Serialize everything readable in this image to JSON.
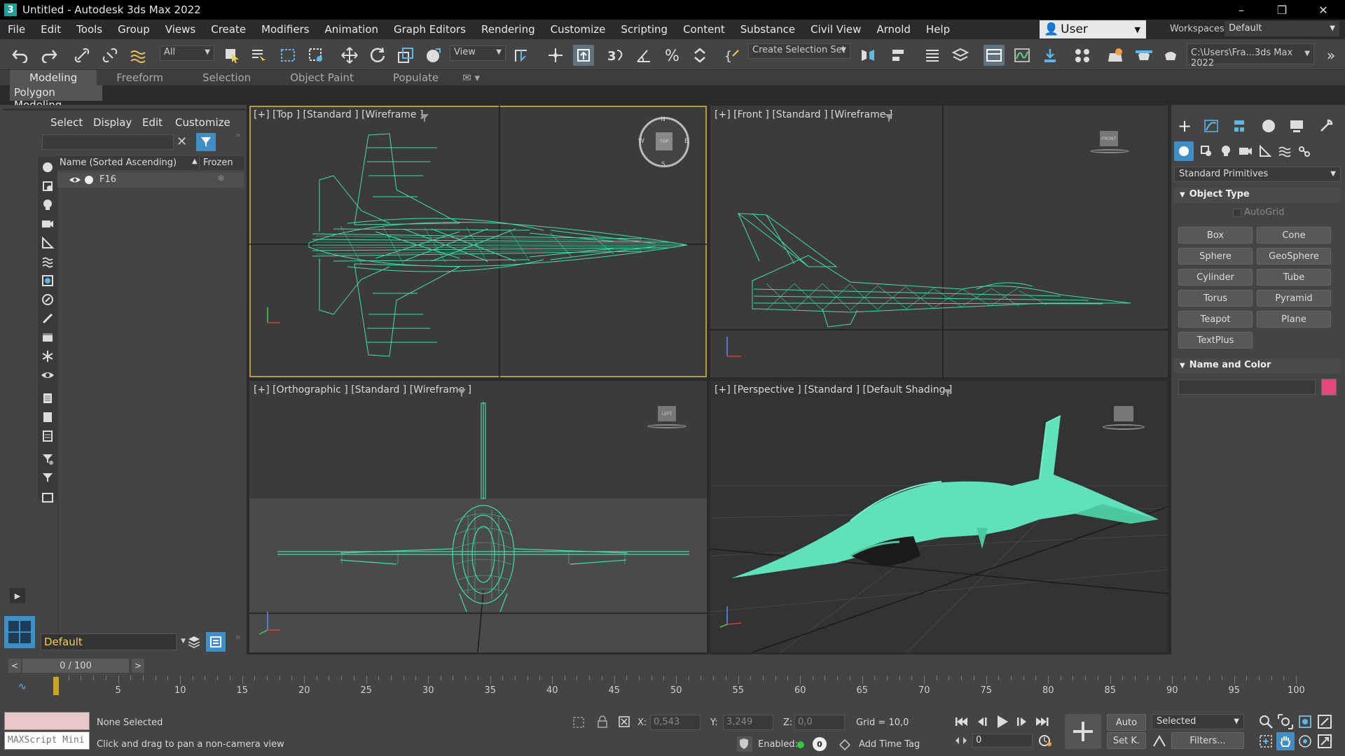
{
  "app": {
    "title": "Untitled - Autodesk 3ds Max 2022",
    "icon_letter": "3"
  },
  "menu": [
    "File",
    "Edit",
    "Tools",
    "Group",
    "Views",
    "Create",
    "Modifiers",
    "Animation",
    "Graph Editors",
    "Rendering",
    "Customize",
    "Scripting",
    "Content",
    "Substance",
    "Civil View",
    "Arnold",
    "Help"
  ],
  "user": {
    "name": "User",
    "workspaces_label": "Workspaces:",
    "workspace": "Default"
  },
  "toolbar": {
    "filter": "All",
    "ref_coord": "View",
    "selection_set": "Create Selection Set",
    "path": "C:\\Users\\Fra...3ds Max 2022"
  },
  "ribbon": {
    "tabs": [
      "Modeling",
      "Freeform",
      "Selection",
      "Object Paint",
      "Populate"
    ],
    "active": "Modeling",
    "subpanel": "Polygon Modeling"
  },
  "explorer": {
    "menus": [
      "Select",
      "Display",
      "Edit",
      "Customize"
    ],
    "col_name": "Name (Sorted Ascending)",
    "col_frozen": "Frozen",
    "items": [
      {
        "name": "F16"
      }
    ],
    "layer": "Default"
  },
  "viewports": {
    "top": "[+] [Top ] [Standard ] [Wireframe ]",
    "front": "[+] [Front ] [Standard ] [Wireframe ]",
    "ortho": "[+] [Orthographic ] [Standard ] [Wireframe ]",
    "persp": "[+] [Perspective ] [Standard ] [Default Shading ]",
    "compass": {
      "n": "N",
      "s": "S",
      "e": "E",
      "w": "W",
      "cube": "TOP"
    },
    "cube_front": "FRONT",
    "cube_left": "LEFT"
  },
  "command_panel": {
    "category": "Standard Primitives",
    "object_type": "Object Type",
    "autogrid": "AutoGrid",
    "buttons": [
      "Box",
      "Cone",
      "Sphere",
      "GeoSphere",
      "Cylinder",
      "Tube",
      "Torus",
      "Pyramid",
      "Teapot",
      "Plane",
      "TextPlus"
    ],
    "name_color": "Name and Color",
    "swatch": "#e8457a"
  },
  "timeline": {
    "frame": "0 / 100",
    "ticks": [
      "0",
      "5",
      "10",
      "15",
      "20",
      "25",
      "30",
      "35",
      "40",
      "45",
      "50",
      "55",
      "60",
      "65",
      "70",
      "75",
      "80",
      "85",
      "90",
      "95",
      "100"
    ]
  },
  "status": {
    "maxscript": "MAXScript Mini",
    "selection": "None Selected",
    "prompt": "Click and drag to pan a non-camera view",
    "x_label": "X:",
    "x": "0,543",
    "y_label": "Y:",
    "y": "3,249",
    "z_label": "Z:",
    "z": "0,0",
    "grid": "Grid = 10,0",
    "enabled": "Enabled:",
    "add_time_tag": "Add Time Tag",
    "auto": "Auto",
    "selected": "Selected",
    "setk": "Set K.",
    "filters": "Filters...",
    "frame_field": "0"
  },
  "colors": {
    "wire": "#3fe0a6",
    "shaded": "#5fe2bc",
    "active_border": "#b59b39"
  }
}
